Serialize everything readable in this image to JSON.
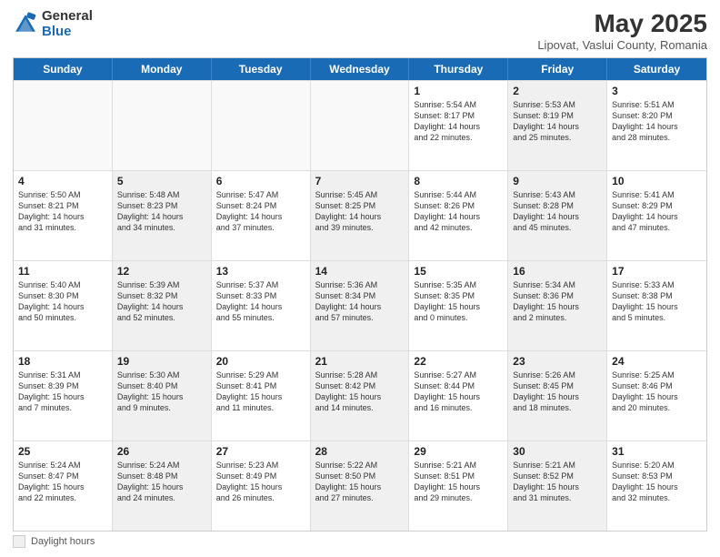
{
  "header": {
    "logo_general": "General",
    "logo_blue": "Blue",
    "month_title": "May 2025",
    "location": "Lipovat, Vaslui County, Romania"
  },
  "days_of_week": [
    "Sunday",
    "Monday",
    "Tuesday",
    "Wednesday",
    "Thursday",
    "Friday",
    "Saturday"
  ],
  "weeks": [
    [
      {
        "day": "",
        "text": "",
        "shaded": false,
        "empty": true
      },
      {
        "day": "",
        "text": "",
        "shaded": false,
        "empty": true
      },
      {
        "day": "",
        "text": "",
        "shaded": false,
        "empty": true
      },
      {
        "day": "",
        "text": "",
        "shaded": false,
        "empty": true
      },
      {
        "day": "1",
        "text": "Sunrise: 5:54 AM\nSunset: 8:17 PM\nDaylight: 14 hours\nand 22 minutes.",
        "shaded": false,
        "empty": false
      },
      {
        "day": "2",
        "text": "Sunrise: 5:53 AM\nSunset: 8:19 PM\nDaylight: 14 hours\nand 25 minutes.",
        "shaded": true,
        "empty": false
      },
      {
        "day": "3",
        "text": "Sunrise: 5:51 AM\nSunset: 8:20 PM\nDaylight: 14 hours\nand 28 minutes.",
        "shaded": false,
        "empty": false
      }
    ],
    [
      {
        "day": "4",
        "text": "Sunrise: 5:50 AM\nSunset: 8:21 PM\nDaylight: 14 hours\nand 31 minutes.",
        "shaded": false,
        "empty": false
      },
      {
        "day": "5",
        "text": "Sunrise: 5:48 AM\nSunset: 8:23 PM\nDaylight: 14 hours\nand 34 minutes.",
        "shaded": true,
        "empty": false
      },
      {
        "day": "6",
        "text": "Sunrise: 5:47 AM\nSunset: 8:24 PM\nDaylight: 14 hours\nand 37 minutes.",
        "shaded": false,
        "empty": false
      },
      {
        "day": "7",
        "text": "Sunrise: 5:45 AM\nSunset: 8:25 PM\nDaylight: 14 hours\nand 39 minutes.",
        "shaded": true,
        "empty": false
      },
      {
        "day": "8",
        "text": "Sunrise: 5:44 AM\nSunset: 8:26 PM\nDaylight: 14 hours\nand 42 minutes.",
        "shaded": false,
        "empty": false
      },
      {
        "day": "9",
        "text": "Sunrise: 5:43 AM\nSunset: 8:28 PM\nDaylight: 14 hours\nand 45 minutes.",
        "shaded": true,
        "empty": false
      },
      {
        "day": "10",
        "text": "Sunrise: 5:41 AM\nSunset: 8:29 PM\nDaylight: 14 hours\nand 47 minutes.",
        "shaded": false,
        "empty": false
      }
    ],
    [
      {
        "day": "11",
        "text": "Sunrise: 5:40 AM\nSunset: 8:30 PM\nDaylight: 14 hours\nand 50 minutes.",
        "shaded": false,
        "empty": false
      },
      {
        "day": "12",
        "text": "Sunrise: 5:39 AM\nSunset: 8:32 PM\nDaylight: 14 hours\nand 52 minutes.",
        "shaded": true,
        "empty": false
      },
      {
        "day": "13",
        "text": "Sunrise: 5:37 AM\nSunset: 8:33 PM\nDaylight: 14 hours\nand 55 minutes.",
        "shaded": false,
        "empty": false
      },
      {
        "day": "14",
        "text": "Sunrise: 5:36 AM\nSunset: 8:34 PM\nDaylight: 14 hours\nand 57 minutes.",
        "shaded": true,
        "empty": false
      },
      {
        "day": "15",
        "text": "Sunrise: 5:35 AM\nSunset: 8:35 PM\nDaylight: 15 hours\nand 0 minutes.",
        "shaded": false,
        "empty": false
      },
      {
        "day": "16",
        "text": "Sunrise: 5:34 AM\nSunset: 8:36 PM\nDaylight: 15 hours\nand 2 minutes.",
        "shaded": true,
        "empty": false
      },
      {
        "day": "17",
        "text": "Sunrise: 5:33 AM\nSunset: 8:38 PM\nDaylight: 15 hours\nand 5 minutes.",
        "shaded": false,
        "empty": false
      }
    ],
    [
      {
        "day": "18",
        "text": "Sunrise: 5:31 AM\nSunset: 8:39 PM\nDaylight: 15 hours\nand 7 minutes.",
        "shaded": false,
        "empty": false
      },
      {
        "day": "19",
        "text": "Sunrise: 5:30 AM\nSunset: 8:40 PM\nDaylight: 15 hours\nand 9 minutes.",
        "shaded": true,
        "empty": false
      },
      {
        "day": "20",
        "text": "Sunrise: 5:29 AM\nSunset: 8:41 PM\nDaylight: 15 hours\nand 11 minutes.",
        "shaded": false,
        "empty": false
      },
      {
        "day": "21",
        "text": "Sunrise: 5:28 AM\nSunset: 8:42 PM\nDaylight: 15 hours\nand 14 minutes.",
        "shaded": true,
        "empty": false
      },
      {
        "day": "22",
        "text": "Sunrise: 5:27 AM\nSunset: 8:44 PM\nDaylight: 15 hours\nand 16 minutes.",
        "shaded": false,
        "empty": false
      },
      {
        "day": "23",
        "text": "Sunrise: 5:26 AM\nSunset: 8:45 PM\nDaylight: 15 hours\nand 18 minutes.",
        "shaded": true,
        "empty": false
      },
      {
        "day": "24",
        "text": "Sunrise: 5:25 AM\nSunset: 8:46 PM\nDaylight: 15 hours\nand 20 minutes.",
        "shaded": false,
        "empty": false
      }
    ],
    [
      {
        "day": "25",
        "text": "Sunrise: 5:24 AM\nSunset: 8:47 PM\nDaylight: 15 hours\nand 22 minutes.",
        "shaded": false,
        "empty": false
      },
      {
        "day": "26",
        "text": "Sunrise: 5:24 AM\nSunset: 8:48 PM\nDaylight: 15 hours\nand 24 minutes.",
        "shaded": true,
        "empty": false
      },
      {
        "day": "27",
        "text": "Sunrise: 5:23 AM\nSunset: 8:49 PM\nDaylight: 15 hours\nand 26 minutes.",
        "shaded": false,
        "empty": false
      },
      {
        "day": "28",
        "text": "Sunrise: 5:22 AM\nSunset: 8:50 PM\nDaylight: 15 hours\nand 27 minutes.",
        "shaded": true,
        "empty": false
      },
      {
        "day": "29",
        "text": "Sunrise: 5:21 AM\nSunset: 8:51 PM\nDaylight: 15 hours\nand 29 minutes.",
        "shaded": false,
        "empty": false
      },
      {
        "day": "30",
        "text": "Sunrise: 5:21 AM\nSunset: 8:52 PM\nDaylight: 15 hours\nand 31 minutes.",
        "shaded": true,
        "empty": false
      },
      {
        "day": "31",
        "text": "Sunrise: 5:20 AM\nSunset: 8:53 PM\nDaylight: 15 hours\nand 32 minutes.",
        "shaded": false,
        "empty": false
      }
    ]
  ],
  "footnote": {
    "label": "Daylight hours"
  }
}
